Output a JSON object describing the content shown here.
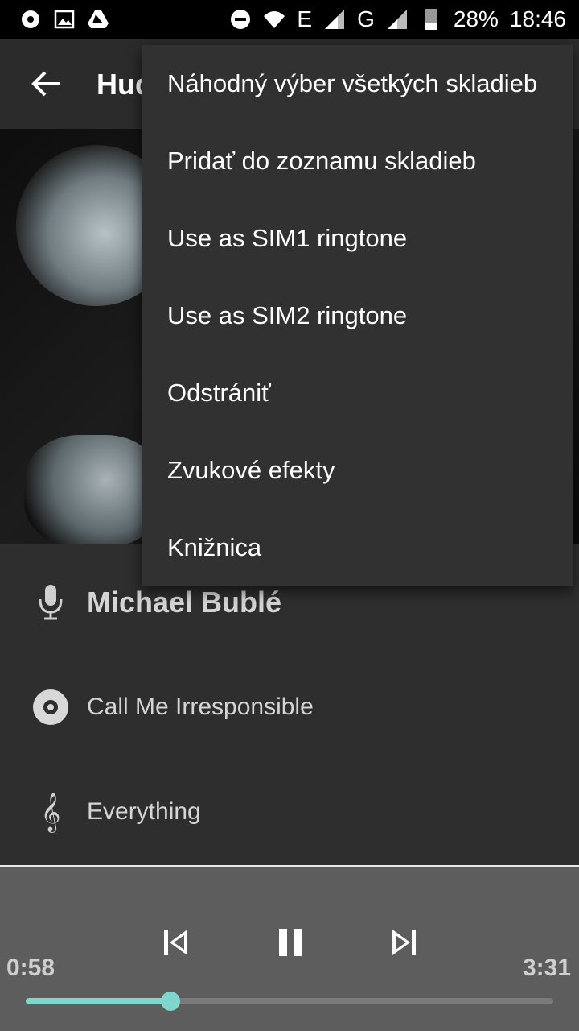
{
  "status_bar": {
    "network_1": "E",
    "network_2": "G",
    "battery": "28%",
    "time": "18:46"
  },
  "toolbar": {
    "title": "Hudba"
  },
  "info": {
    "artist": "Michael Bublé",
    "album": "Call Me Irresponsible",
    "song": "Everything"
  },
  "player": {
    "elapsed": "0:58",
    "duration": "3:31",
    "progress": 0.275
  },
  "menu": {
    "items": [
      "Náhodný výber všetkých skladieb",
      "Pridať do zoznamu skladieb",
      "Use as SIM1 ringtone",
      "Use as SIM2 ringtone",
      "Odstrániť",
      "Zvukové efekty",
      "Knižnica"
    ]
  },
  "colors": {
    "accent": "#7fd6cc",
    "menu_bg": "#313131",
    "player_bg": "#5d5d5d"
  }
}
